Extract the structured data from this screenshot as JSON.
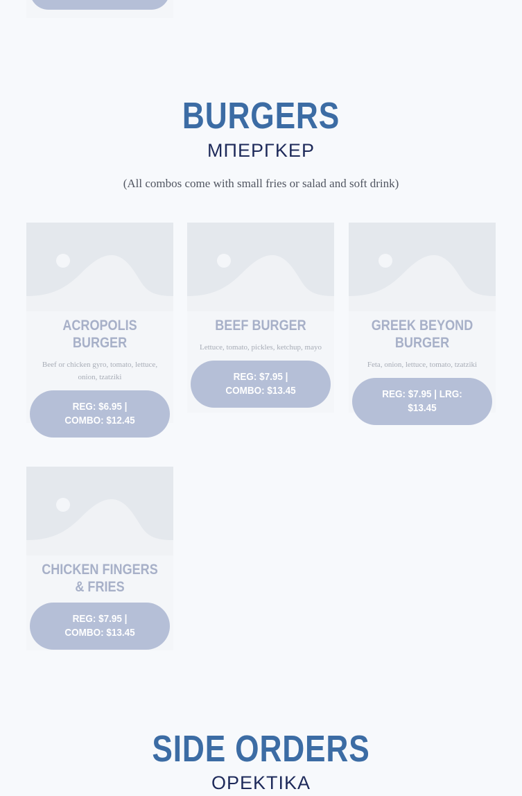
{
  "burgers": {
    "title": "BURGERS",
    "subtitle": "ΜΠΕΡΓΚΕΡ",
    "note": "(All combos come with small fries or salad and soft drink)",
    "items": [
      {
        "name": "ACROPOLIS BURGER",
        "description": "Beef or chicken gyro, tomato, lettuce, onion, tzatziki",
        "price": "REG: $6.95 | COMBO: $12.45"
      },
      {
        "name": "BEEF BURGER",
        "description": "Lettuce, tomato, pickles, ketchup, mayo",
        "price": "REG: $7.95 | COMBO: $13.45"
      },
      {
        "name": "GREEK BEYOND BURGER",
        "description": "Feta, onion, lettuce, tomato, tzatziki",
        "price": "REG: $7.95 | LRG: $13.45"
      },
      {
        "name": "CHICKEN FINGERS & FRIES",
        "description": "",
        "price": "REG: $7.95 | COMBO: $13.45"
      }
    ]
  },
  "side_orders": {
    "title": "SIDE ORDERS",
    "subtitle": "ΟΡΕΚΤΙΚΑ"
  },
  "icons": {
    "placeholder": "image-placeholder-icon"
  },
  "colors": {
    "title": "#3c6ca4",
    "subtitle": "#1e2a5a",
    "button": "#b5bfd7",
    "card_name": "#a7b0c8"
  }
}
